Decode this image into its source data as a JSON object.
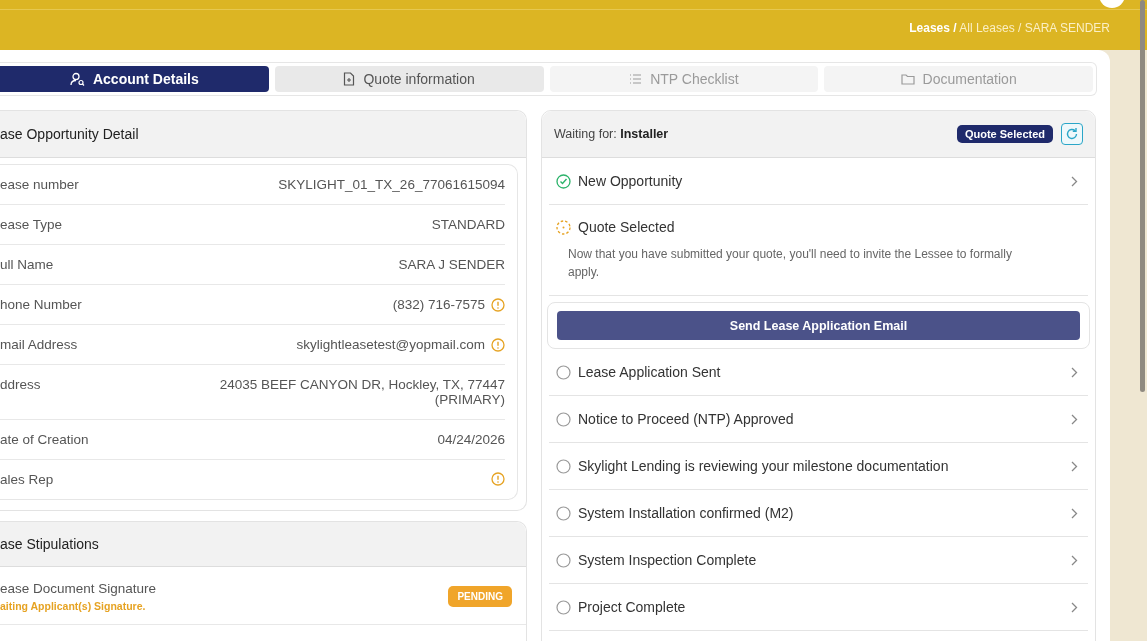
{
  "breadcrumb": {
    "root": "Leases /",
    "trail": "All Leases / SARA SENDER"
  },
  "tabs": [
    {
      "label": "Account Details",
      "selected": true,
      "disabled": false
    },
    {
      "label": "Quote information",
      "selected": false,
      "disabled": false
    },
    {
      "label": "NTP Checklist",
      "selected": false,
      "disabled": true
    },
    {
      "label": "Documentation",
      "selected": false,
      "disabled": true
    }
  ],
  "detail": {
    "title": "ase Opportunity Detail",
    "rows": [
      {
        "label": "ease number",
        "value": "SKYLIGHT_01_TX_26_77061615094",
        "warning": false
      },
      {
        "label": "ease Type",
        "value": "STANDARD",
        "warning": false
      },
      {
        "label": "ull Name",
        "value": "SARA J SENDER",
        "warning": false
      },
      {
        "label": "hone Number",
        "value": "(832) 716-7575",
        "warning": true
      },
      {
        "label": "mail Address",
        "value": "skylightleasetest@yopmail.com",
        "warning": true
      },
      {
        "label": "ddress",
        "value": "24035 BEEF CANYON DR, Hockley, TX, 77447 (PRIMARY)",
        "warning": false
      },
      {
        "label": "ate of Creation",
        "value": "04/24/2026",
        "warning": false
      },
      {
        "label": "ales Rep",
        "value": "",
        "warning": true
      }
    ]
  },
  "stipulations": {
    "title": "ase Stipulations",
    "items": [
      {
        "name": "ease Document Signature",
        "note": "aiting Applicant(s) Signature.",
        "status": "PENDING"
      }
    ]
  },
  "progress": {
    "waiting_label": "Waiting for:",
    "waiting_for": "Installer",
    "badge": "Quote Selected",
    "steps": [
      {
        "kind": "done",
        "title": "New Opportunity"
      },
      {
        "kind": "current",
        "title": "Quote Selected",
        "description": "Now that you have submitted your quote, you'll need to invite the Lessee to formally apply.",
        "action": "Send Lease Application Email"
      },
      {
        "kind": "pending",
        "title": "Lease Application Sent"
      },
      {
        "kind": "pending",
        "title": "Notice to Proceed (NTP) Approved"
      },
      {
        "kind": "pending",
        "title": "Skylight Lending is reviewing your milestone documentation"
      },
      {
        "kind": "pending",
        "title": "System Installation confirmed (M2)"
      },
      {
        "kind": "pending",
        "title": "System Inspection Complete"
      },
      {
        "kind": "pending",
        "title": "Project Complete"
      }
    ]
  }
}
